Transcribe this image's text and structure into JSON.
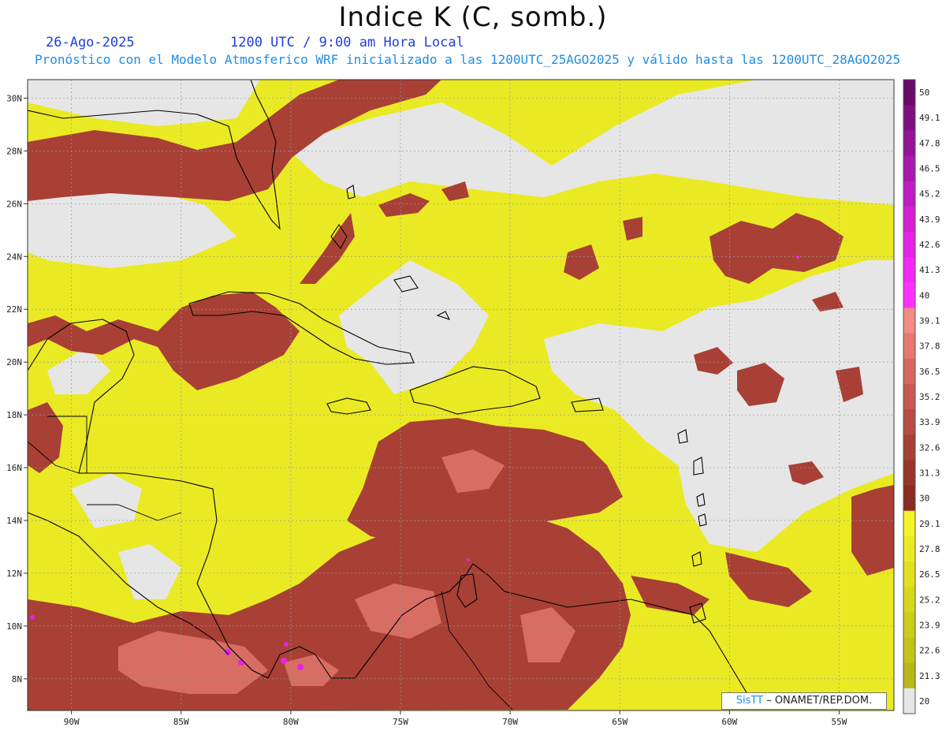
{
  "title": "Indice K (C, somb.)",
  "date": "26-Ago-2025",
  "time_label": "1200 UTC / 9:00 am Hora Local",
  "forecast_line": "Pronóstico con el Modelo Atmosferico WRF inicializado a las 1200UTC_25AGO2025 y válido hasta las  1200UTC_28AGO2025",
  "map": {
    "lon_labels": [
      "90W",
      "85W",
      "80W",
      "75W",
      "70W",
      "65W",
      "60W",
      "55W"
    ],
    "lat_labels": [
      "30N",
      "28N",
      "26N",
      "24N",
      "22N",
      "20N",
      "18N",
      "16N",
      "14N",
      "12N",
      "10N",
      "8N"
    ],
    "lon_range": [
      -92,
      -52.5
    ],
    "lat_range": [
      6.8,
      30.7
    ],
    "grid": true
  },
  "colorbar": {
    "labels": [
      "50",
      "49.1",
      "47.8",
      "46.5",
      "45.2",
      "43.9",
      "42.6",
      "41.3",
      "40",
      "39.1",
      "37.8",
      "36.5",
      "35.2",
      "33.9",
      "32.6",
      "31.3",
      "30",
      "29.1",
      "27.8",
      "26.5",
      "25.2",
      "23.9",
      "22.6",
      "21.3",
      "20"
    ],
    "colors": [
      "#6a0a6a",
      "#7d1080",
      "#931496",
      "#aa18ae",
      "#c01cc4",
      "#d41fd6",
      "#e622e6",
      "#f428f4",
      "#ff30ff",
      "#f28a86",
      "#e8786e",
      "#d8665c",
      "#c85850",
      "#b84c42",
      "#a84036",
      "#98362c",
      "#8a2c22",
      "#f4f428",
      "#eaea24",
      "#e0e020",
      "#d6d61e",
      "#cccc1c",
      "#c2c21a",
      "#b8b818",
      "#e6e6e6"
    ]
  },
  "credit": {
    "brand": "SisTT",
    "text": " – ONAMET/REP.DOM."
  }
}
